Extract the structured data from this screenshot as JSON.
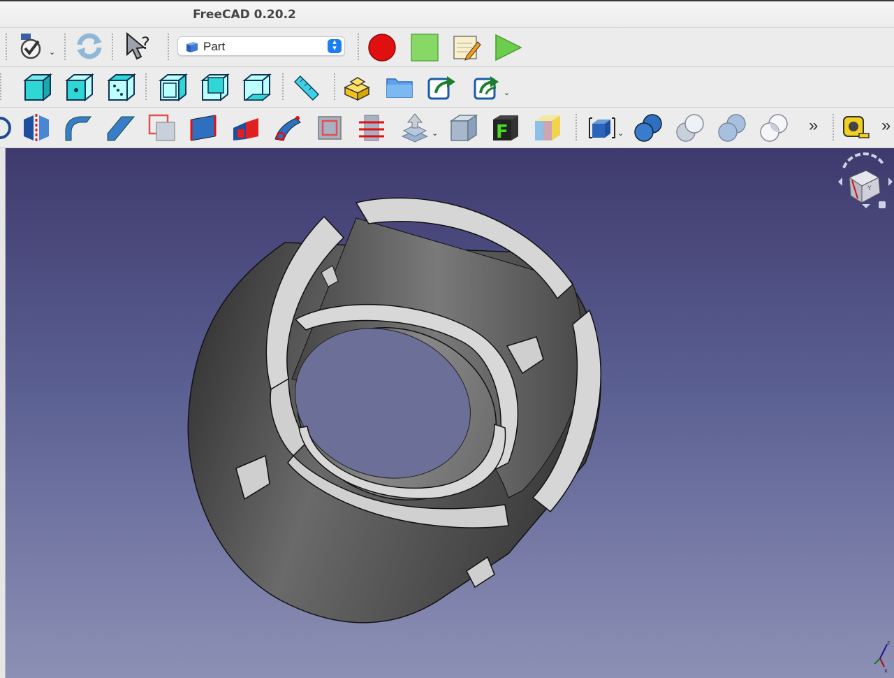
{
  "window": {
    "title": "FreeCAD 0.20.2"
  },
  "workbench": {
    "selected": "Part",
    "icon": "part-cube-icon"
  },
  "toolbar_row1": [
    "std-checkbox-icon",
    "refresh-icon",
    "whats-this-icon",
    "workbench-selector",
    "macro-record-icon",
    "macro-stop-icon",
    "macro-edit-icon",
    "macro-run-icon"
  ],
  "toolbar_row2": [
    "view-axo-icon",
    "view-front-icon",
    "view-top-icon",
    "view-right-icon",
    "view-rear-icon",
    "view-bottom-icon",
    "measure-ruler-icon",
    "part-box-icon",
    "open-folder-icon",
    "export-icon",
    "export-dropdown-icon"
  ],
  "toolbar_row3": [
    "revolve-icon",
    "mirror-icon",
    "fillet-icon",
    "chamfer-icon",
    "make-face-icon",
    "ruled-surface-icon",
    "loft-icon",
    "sweep-icon",
    "section-icon",
    "cross-sections-icon",
    "offset-icon",
    "thickness-icon",
    "projection-icon",
    "shape-color-icon",
    "compound-icon",
    "boolean-icon",
    "cut-icon",
    "fuse-icon",
    "common-icon",
    "more-tools-icon",
    "measure-tape-icon",
    "overflow-icon"
  ],
  "overflow": {
    "glyph": "»"
  },
  "navcube": {
    "face_label": "Y",
    "axis_x": "x",
    "axis_z": "z"
  },
  "colors": {
    "viewport_top": "#3f3a6e",
    "viewport_bottom": "#8d90b5",
    "part_face": "#d4d4d4",
    "part_side": "#5a5a5a",
    "record": "#e01010",
    "stop": "#88d868",
    "run": "#6ccc4c",
    "view_cube": "#2fd6d6"
  }
}
